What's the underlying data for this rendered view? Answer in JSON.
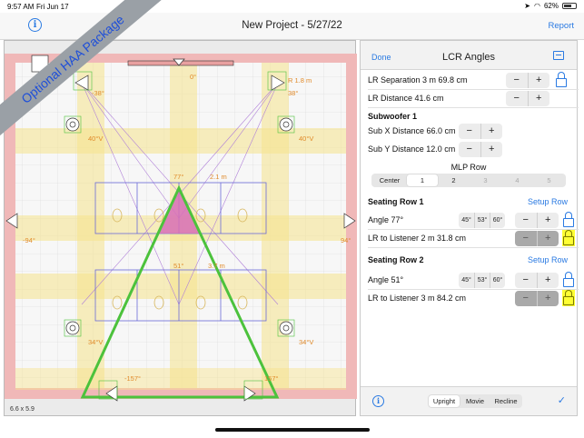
{
  "status": {
    "time": "9:57 AM",
    "date": "Fri Jun 17",
    "battery": "62%"
  },
  "nav": {
    "title": "New Project - 5/27/22",
    "report": "Report",
    "info": "i"
  },
  "banner": "Optional HAA Package",
  "room": {
    "size": "6.6 x 5.9",
    "labels": {
      "lr_sep": "R 1.8 m",
      "top_zero": "0°",
      "front_left_angle": "-38°",
      "front_right_angle": "38°",
      "left_upper_v": "40°V",
      "right_upper_v": "40°V",
      "row1_angle": "77°",
      "row1_dist": "2.1 m",
      "left_side": "-94°",
      "right_side": "94°",
      "row2_angle": "51°",
      "row2_dist": "3.7 m",
      "left_lower_v": "34°V",
      "right_lower_v": "34°V",
      "rear_left": "-157°",
      "rear_right": "157°"
    }
  },
  "panel": {
    "done": "Done",
    "title": "LCR Angles",
    "lr_separation": "LR Separation 3 m 69.8 cm",
    "lr_distance": "LR Distance 41.6 cm",
    "sub_title": "Subwoofer 1",
    "sub_x": "Sub X Distance 66.0 cm",
    "sub_y": "Sub Y Distance 12.0 cm",
    "mlp_row": "MLP Row",
    "mlp_options": [
      "Center",
      "1",
      "2",
      "3",
      "4",
      "5"
    ],
    "stepper": {
      "minus": "−",
      "plus": "+"
    },
    "seating1": {
      "title": "Seating Row 1",
      "setup": "Setup Row",
      "angle": "Angle  77°",
      "angle_options": [
        "45°",
        "53°",
        "60°"
      ],
      "lr_listener": "LR to Listener 2 m 31.8 cm"
    },
    "seating2": {
      "title": "Seating Row 2",
      "setup": "Setup Row",
      "angle": "Angle  51°",
      "angle_options": [
        "45°",
        "53°",
        "60°"
      ],
      "lr_listener": "LR to Listener 3 m 84.2 cm"
    },
    "footer": {
      "info": "i",
      "modes": [
        "Upright",
        "Movie",
        "Recline"
      ],
      "check": "✓"
    }
  }
}
